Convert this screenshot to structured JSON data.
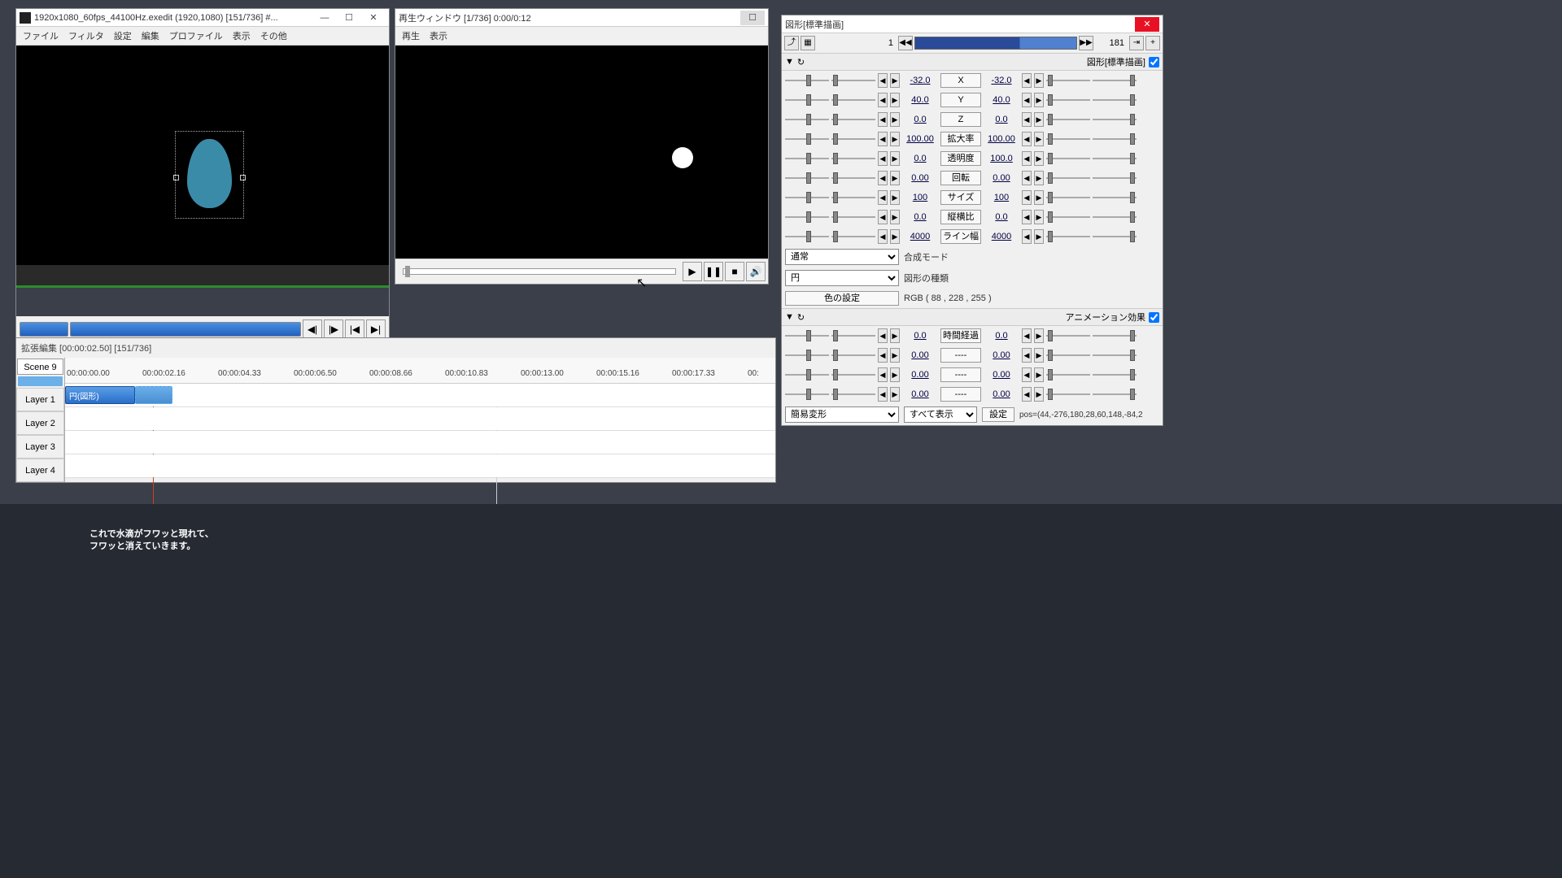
{
  "main_window": {
    "title": "1920x1080_60fps_44100Hz.exedit (1920,1080)  [151/736]  #...",
    "menu": [
      "ファイル",
      "フィルタ",
      "設定",
      "編集",
      "プロファイル",
      "表示",
      "その他"
    ]
  },
  "playback_window": {
    "title": "再生ウィンドウ  [1/736]  0:00/0:12",
    "menu": [
      "再生",
      "表示"
    ]
  },
  "timeline": {
    "title": "拡張編集 [00:00:02.50] [151/736]",
    "scene": "Scene 9",
    "marks": [
      "00:00:00.00",
      "00:00:02.16",
      "00:00:04.33",
      "00:00:06.50",
      "00:00:08.66",
      "00:00:10.83",
      "00:00:13.00",
      "00:00:15.16",
      "00:00:17.33",
      "00:"
    ],
    "layers": [
      "Layer 1",
      "Layer 2",
      "Layer 3",
      "Layer 4"
    ],
    "clip_label": "円(図形)"
  },
  "props": {
    "title": "図形[標準描画]",
    "frame_cur": "1",
    "frame_end": "181",
    "section1": "図形[標準描画]",
    "rows": [
      {
        "v1": "-32.0",
        "label": "X",
        "v2": "-32.0"
      },
      {
        "v1": "40.0",
        "label": "Y",
        "v2": "40.0"
      },
      {
        "v1": "0.0",
        "label": "Z",
        "v2": "0.0"
      },
      {
        "v1": "100.00",
        "label": "拡大率",
        "v2": "100.00"
      },
      {
        "v1": "0.0",
        "label": "透明度",
        "v2": "100.0"
      },
      {
        "v1": "0.00",
        "label": "回転",
        "v2": "0.00"
      },
      {
        "v1": "100",
        "label": "サイズ",
        "v2": "100"
      },
      {
        "v1": "0.0",
        "label": "縦横比",
        "v2": "0.0"
      },
      {
        "v1": "4000",
        "label": "ライン幅",
        "v2": "4000"
      }
    ],
    "blend_mode": "通常",
    "blend_label": "合成モード",
    "shape_type": "円",
    "shape_label": "図形の種類",
    "color_label": "色の設定",
    "color_value": "RGB ( 88 , 228 , 255 )",
    "section2": "アニメーション効果",
    "anim_rows": [
      {
        "v1": "0.0",
        "label": "時間経過",
        "v2": "0.0"
      },
      {
        "v1": "0.00",
        "label": "----",
        "v2": "0.00"
      },
      {
        "v1": "0.00",
        "label": "----",
        "v2": "0.00"
      },
      {
        "v1": "0.00",
        "label": "----",
        "v2": "0.00"
      }
    ],
    "anim_type": "簡易変形",
    "anim_filter": "すべて表示",
    "settings_btn": "設定",
    "pos_text": "pos=(44,-276,180,28,60,148,-84,2"
  },
  "caption": {
    "line1": "これで水滴がフワッと現れて、",
    "line2": "フワッと消えていきます。"
  }
}
